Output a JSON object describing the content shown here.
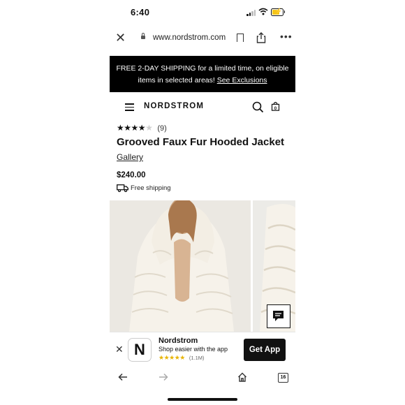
{
  "status": {
    "time": "6:40"
  },
  "browser": {
    "url": "www.nordstrom.com"
  },
  "promo": {
    "text": "FREE 2-DAY SHIPPING for a limited time, on eligible items in selected areas!",
    "link": "See Exclusions"
  },
  "site": {
    "logo": "NORDSTROM"
  },
  "product": {
    "rating": 4,
    "max_rating": 5,
    "review_count": "(9)",
    "title": "Grooved Faux Fur Hooded Jacket",
    "brand": "Gallery",
    "price": "$240.00",
    "shipping": "Free shipping"
  },
  "app_banner": {
    "icon_letter": "N",
    "name": "Nordstrom",
    "tagline": "Shop easier with the app",
    "rating_count": "(1.1M)",
    "cta": "Get App"
  },
  "toolbar": {
    "tab_count": "16"
  }
}
